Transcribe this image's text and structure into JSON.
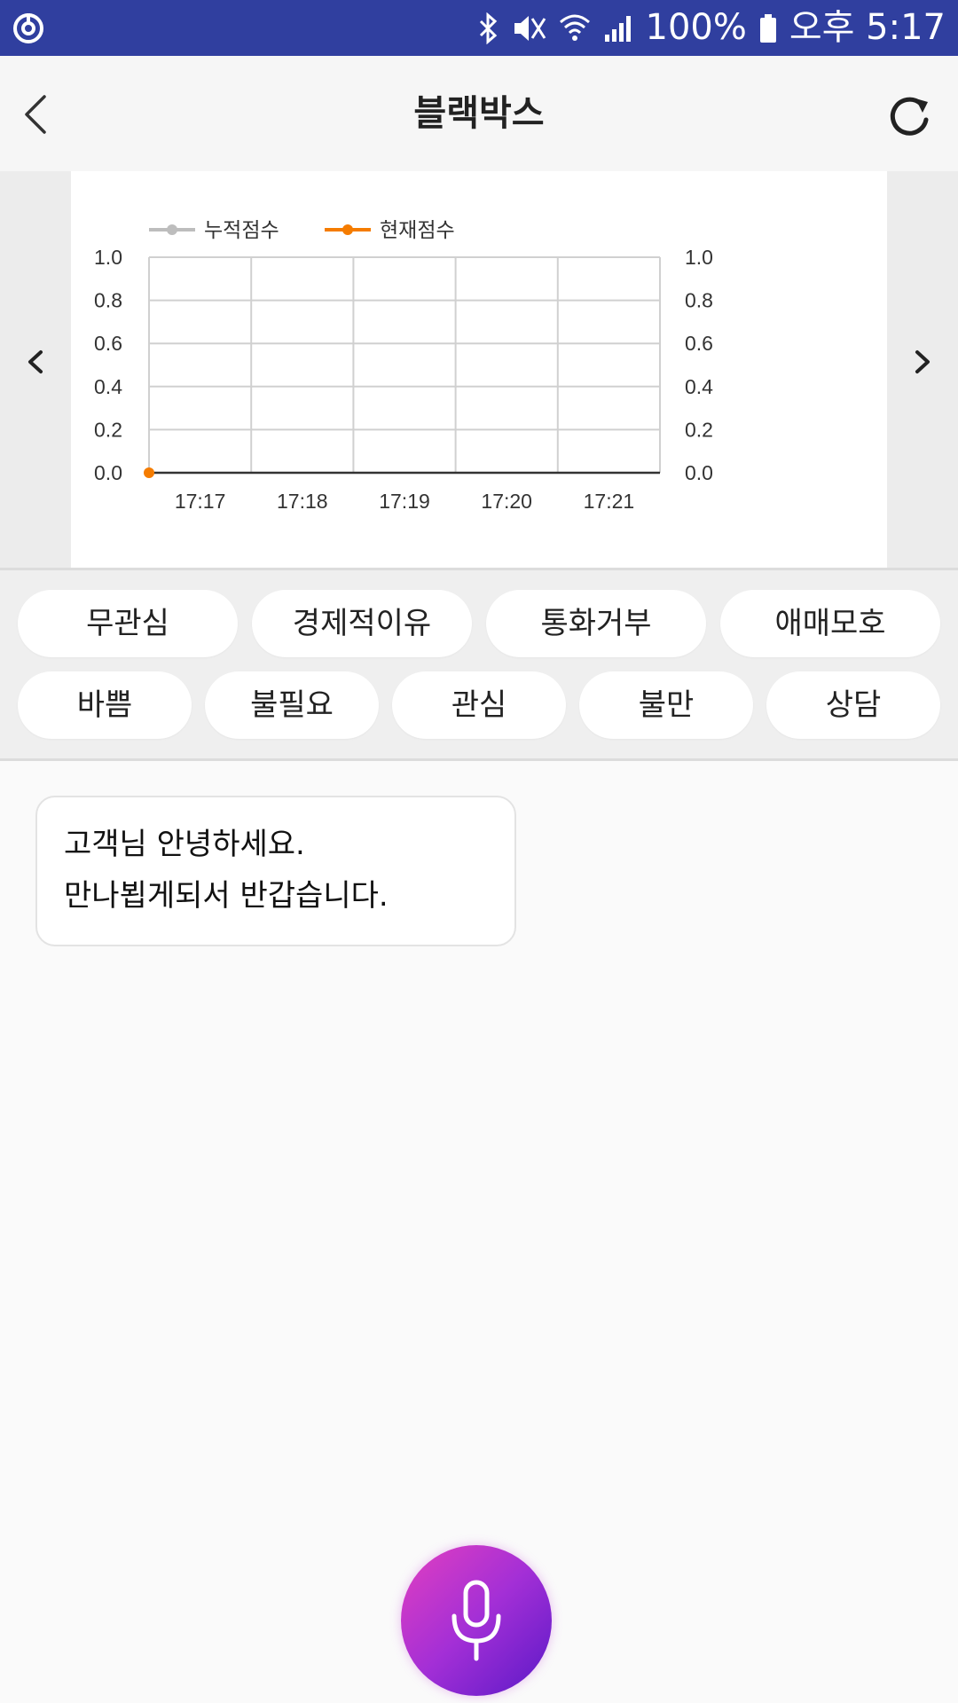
{
  "status_bar": {
    "battery": "100%",
    "time": "오후 5:17",
    "icons": [
      "app-notification-icon",
      "bluetooth-icon",
      "mute-icon",
      "wifi-icon",
      "signal-icon",
      "battery-icon"
    ]
  },
  "header": {
    "title": "블랙박스",
    "back_icon": "chevron-left-icon",
    "refresh_icon": "refresh-icon"
  },
  "chart_data": {
    "type": "line",
    "x": [
      "17:17",
      "17:18",
      "17:19",
      "17:20",
      "17:21"
    ],
    "y_ticks": [
      "0.0",
      "0.2",
      "0.4",
      "0.6",
      "0.8",
      "1.0"
    ],
    "ylim": [
      0,
      1.0
    ],
    "y2lim": [
      0,
      1.0
    ],
    "legend_position": "top-left",
    "grid": true,
    "series": [
      {
        "name": "누적점수",
        "color": "#bdbdbd",
        "values": []
      },
      {
        "name": "현재점수",
        "color": "#f57c00",
        "points": [
          {
            "x": "17:16:30",
            "y": 0.0
          }
        ]
      }
    ]
  },
  "tags_row1": [
    "무관심",
    "경제적이유",
    "통화거부",
    "애매모호"
  ],
  "tags_row2": [
    "바쁨",
    "불필요",
    "관심",
    "불만",
    "상담"
  ],
  "message": {
    "line1": "고객님 안녕하세요.",
    "line2": "만나뵙게되서 반갑습니다."
  },
  "mic_icon": "microphone-icon",
  "colors": {
    "status_bar": "#303f9f",
    "accent_orange": "#f57c00",
    "mic_gradient_start": "#e33fc0",
    "mic_gradient_end": "#5a19c7"
  }
}
